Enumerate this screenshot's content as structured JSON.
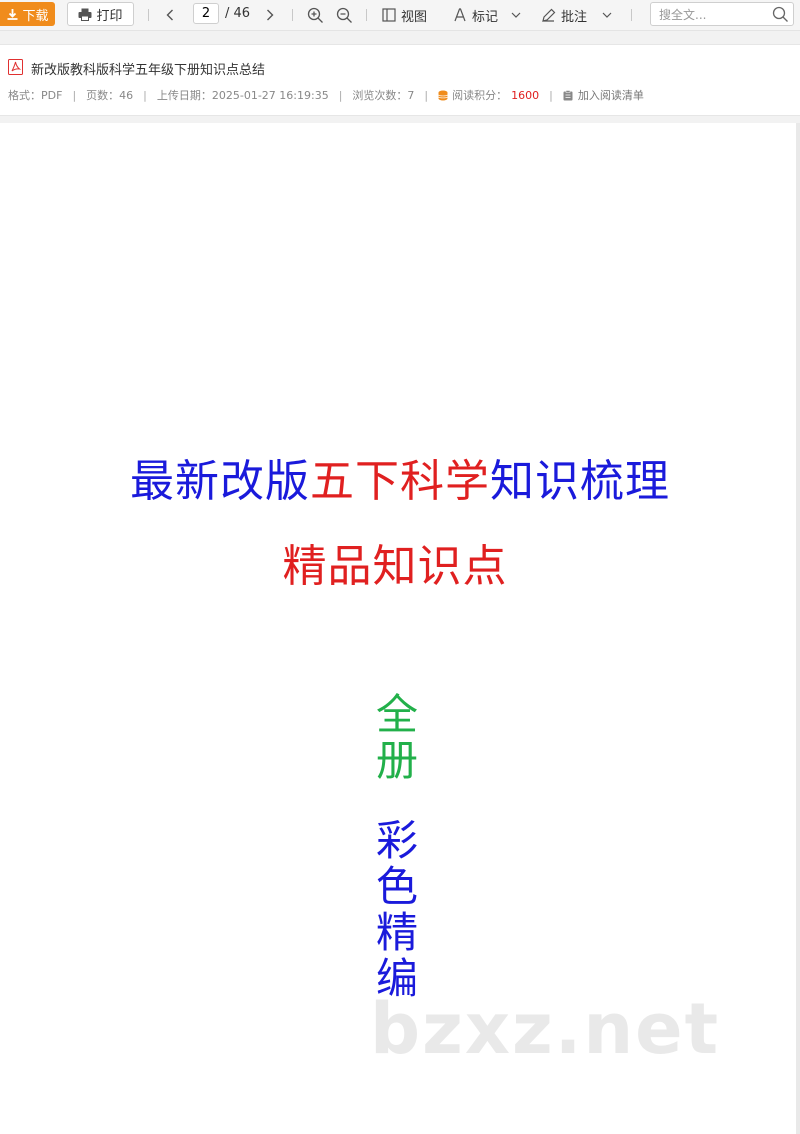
{
  "toolbar": {
    "download_label": "下载",
    "print_label": "打印",
    "current_page": "2",
    "total_pages": "/ 46",
    "view_label": "视图",
    "mark_label": "标记",
    "annotate_label": "批注",
    "search_placeholder": "搜全文..."
  },
  "document": {
    "title": "新改版教科版科学五年级下册知识点总结",
    "meta": {
      "format": "格式：PDF",
      "pages": "页数：46",
      "upload_date": "上传日期：2025-01-27 16:19:35",
      "views": "浏览次数：7",
      "score_label": "阅读积分：",
      "score_value": "1600",
      "add_to_list": "加入阅读清单"
    }
  },
  "page_content": {
    "title_part1": "最新改版",
    "title_part2": "五下科学",
    "title_part3": "知识梳理",
    "subtitle": "精品知识点",
    "vertical1": [
      "全",
      "册"
    ],
    "vertical2": [
      "彩",
      "色",
      "精",
      "编"
    ],
    "watermark": "bzxz.net"
  },
  "colors": {
    "accent": "#f08c1c",
    "blue_text": "#1a1adb",
    "red_text": "#e02020",
    "green_text": "#22b04a"
  }
}
